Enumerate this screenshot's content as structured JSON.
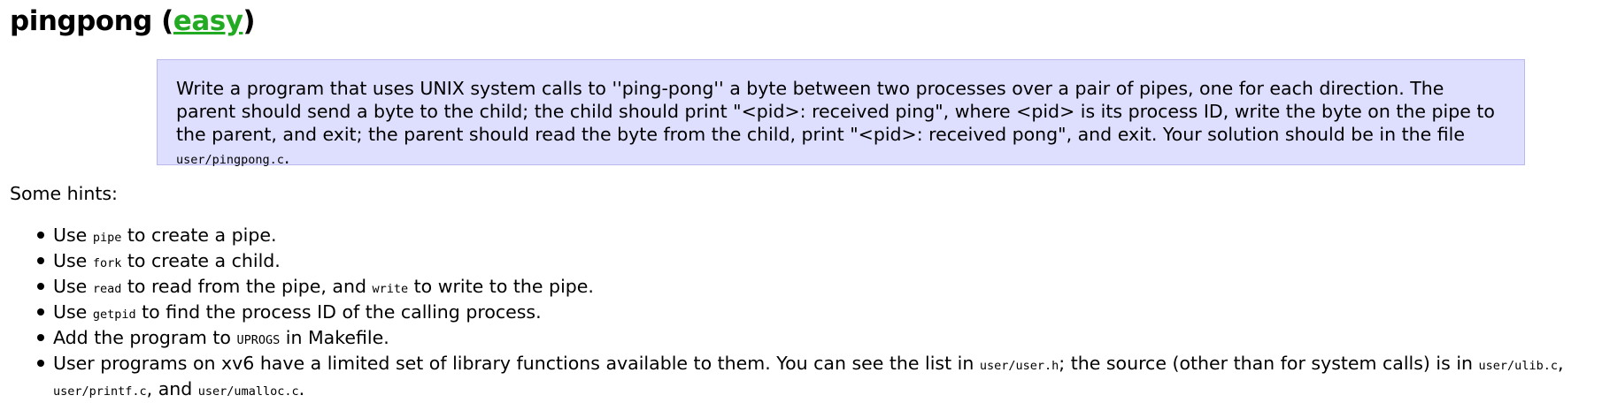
{
  "heading": {
    "name": "pingpong",
    "open_paren": " (",
    "difficulty": "easy",
    "close_paren": ")"
  },
  "requirement": {
    "text": "Write a program that uses UNIX system calls to ''ping-pong'' a byte between two processes over a pair of pipes, one for each direction. The parent should send a byte to the child; the child should print \"<pid>: received ping\", where <pid> is its process ID, write the byte on the pipe to the parent, and exit; the parent should read the byte from the child, print \"<pid>: received pong\", and exit. Your solution should be in the file ",
    "file": "user/pingpong.c",
    "end": "."
  },
  "hints_label": "Some hints:",
  "hints": [
    {
      "a": "Use ",
      "code1": "pipe",
      "b": " to create a pipe."
    },
    {
      "a": "Use ",
      "code1": "fork",
      "b": " to create a child."
    },
    {
      "a": "Use ",
      "code1": "read",
      "b": " to read from the pipe, and ",
      "code2": "write",
      "c": " to write to the pipe."
    },
    {
      "a": "Use ",
      "code1": "getpid",
      "b": " to find the process ID of the calling process."
    },
    {
      "a": "Add the program to ",
      "code1": "UPROGS",
      "b": " in Makefile."
    },
    {
      "a": "User programs on xv6 have a limited set of library functions available to them. You can see the list in ",
      "code1": "user/user.h",
      "b": "; the source (other than for system calls) is in ",
      "code2": "user/ulib.c",
      "c": ", ",
      "code3": "user/printf.c",
      "d": ", and ",
      "code4": "user/umalloc.c",
      "e": "."
    }
  ]
}
